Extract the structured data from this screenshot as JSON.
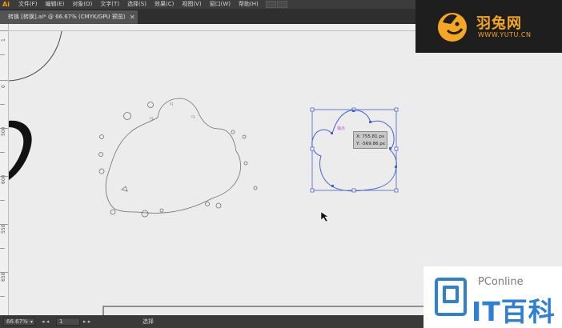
{
  "app": {
    "logo": "Ai"
  },
  "menu": {
    "items": [
      "文件(F)",
      "编辑(E)",
      "对象(O)",
      "文字(T)",
      "选择(S)",
      "效果(C)",
      "视图(V)",
      "窗口(W)",
      "帮助(H)"
    ]
  },
  "document_tab": {
    "title": "转换 [转换].ai* @ 66.67% (CMYK/GPU 预览)",
    "close": "✕"
  },
  "rulers": {
    "vertical_labels": [
      "1",
      "0",
      "500",
      "600",
      "550",
      "650",
      "400",
      "350",
      "300"
    ]
  },
  "canvas": {
    "readout_x": "X: 755.81 px",
    "readout_y": "Y: -569.86 px",
    "anchor_label": "锚点"
  },
  "statusbar": {
    "zoom": "66.67%",
    "page": "1",
    "tool": "选择",
    "nav_prev": "◂ ◂",
    "nav_next": "▸ ▸"
  },
  "watermarks": {
    "yutu_name": "羽兔网",
    "yutu_url": "WWW.YUTU.CN",
    "pc_brand": "PConline",
    "pc_title": "IT百科"
  },
  "colors": {
    "selection": "#4a62c7",
    "accent_orange": "#f5a623",
    "pc_blue": "#2f7fd3"
  }
}
